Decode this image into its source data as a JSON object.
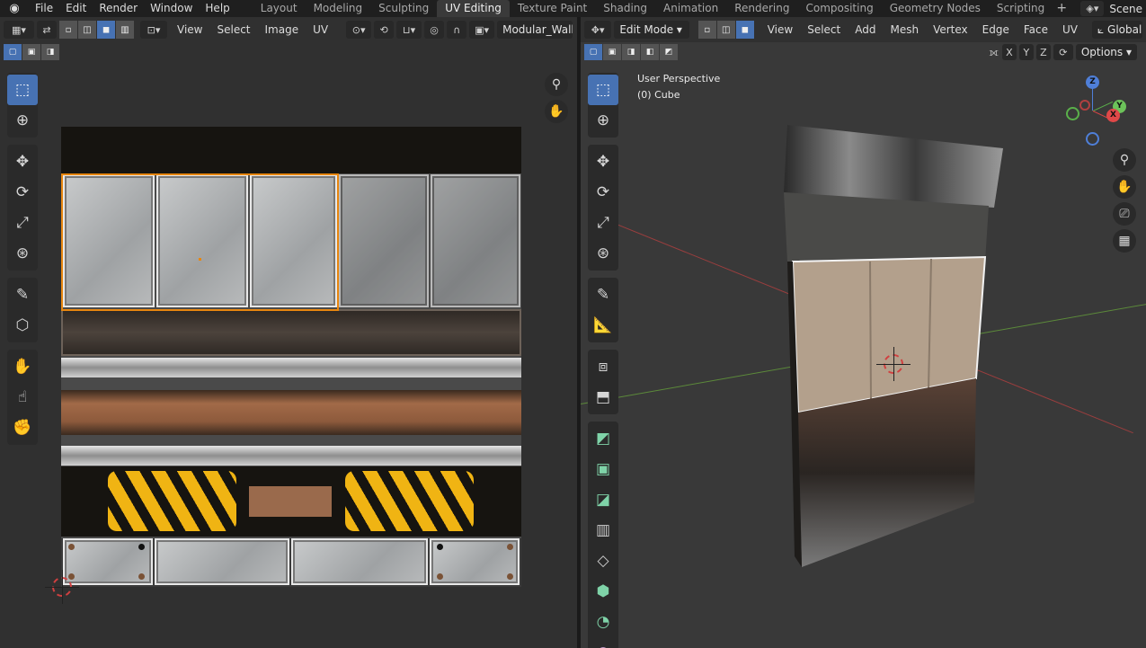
{
  "topbar": {
    "menu": [
      "File",
      "Edit",
      "Render",
      "Window",
      "Help"
    ],
    "workspaces": [
      "Layout",
      "Modeling",
      "Sculpting",
      "UV Editing",
      "Texture Paint",
      "Shading",
      "Animation",
      "Rendering",
      "Compositing",
      "Geometry Nodes",
      "Scripting"
    ],
    "active_workspace": "UV Editing",
    "add_label": "+",
    "scene_label": "Scene"
  },
  "uv_editor": {
    "menus": [
      "View",
      "Select",
      "Image",
      "UV"
    ],
    "image_name": "Modular_Wall_"
  },
  "viewport": {
    "mode": "Edit Mode",
    "menus": [
      "View",
      "Select",
      "Add",
      "Mesh",
      "Vertex",
      "Edge",
      "Face",
      "UV"
    ],
    "orientation": "Global",
    "axis_buttons": [
      "X",
      "Y",
      "Z"
    ],
    "options_label": "Options",
    "perspective_label": "User Perspective",
    "object_label": "(0) Cube",
    "gizmo": {
      "x": "X",
      "y": "Y",
      "z": "Z"
    }
  },
  "colors": {
    "accent": "#4772b3",
    "selection": "#e8860f",
    "hazard": "#f0b413"
  }
}
